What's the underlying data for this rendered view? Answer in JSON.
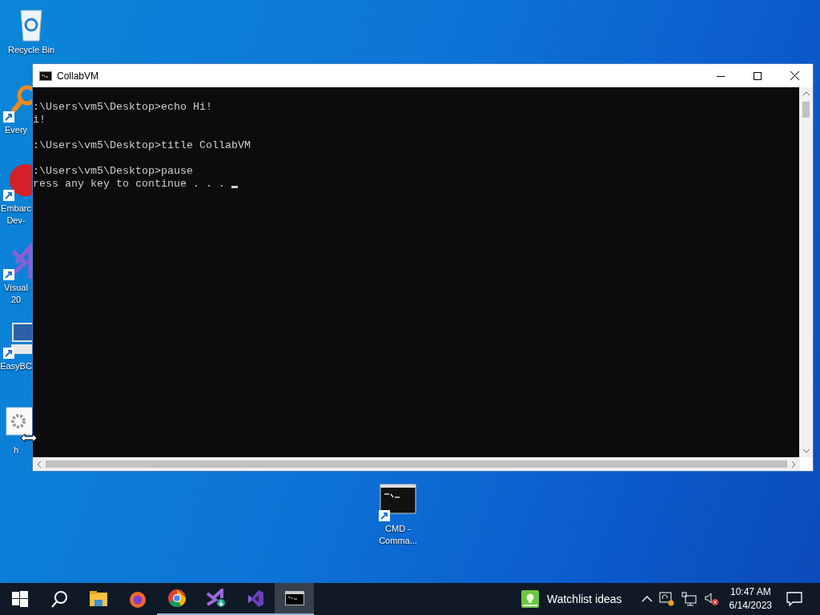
{
  "desktop_icons": [
    {
      "kind": "recycle-bin",
      "label_lines": [
        "Recycle Bin"
      ]
    },
    {
      "kind": "everything",
      "label_lines": [
        "Every"
      ]
    },
    {
      "kind": "embarcadero",
      "label_lines": [
        "Embarc",
        "Dev-"
      ]
    },
    {
      "kind": "visual-studio",
      "label_lines": [
        "Visual",
        "20"
      ]
    },
    {
      "kind": "easybcd",
      "label_lines": [
        "EasyBC"
      ]
    },
    {
      "kind": "settings",
      "label_lines": [
        "h"
      ]
    },
    {
      "kind": "cmd",
      "label_lines": [
        "CMD -",
        "Comma..."
      ]
    }
  ],
  "window": {
    "title": "CollabVM",
    "console_blocks": [
      [
        ":\\Users\\vm5\\Desktop>echo Hi!",
        "i!"
      ],
      [
        ":\\Users\\vm5\\Desktop>title CollabVM"
      ],
      [
        ":\\Users\\vm5\\Desktop>pause",
        "ress any key to continue . . . "
      ]
    ]
  },
  "taskbar": {
    "apps": [
      {
        "kind": "start",
        "running": false,
        "selected": false
      },
      {
        "kind": "search",
        "running": false,
        "selected": false
      },
      {
        "kind": "explorer",
        "running": false,
        "selected": false
      },
      {
        "kind": "firefox",
        "running": false,
        "selected": false
      },
      {
        "kind": "chrome",
        "running": true,
        "selected": false
      },
      {
        "kind": "vs-installer",
        "running": true,
        "selected": false
      },
      {
        "kind": "visual-studio",
        "running": true,
        "selected": false
      },
      {
        "kind": "cmd",
        "running": true,
        "selected": true
      }
    ],
    "notification": "Watchlist ideas",
    "time": "10:47 AM",
    "date": "6/14/2023"
  }
}
